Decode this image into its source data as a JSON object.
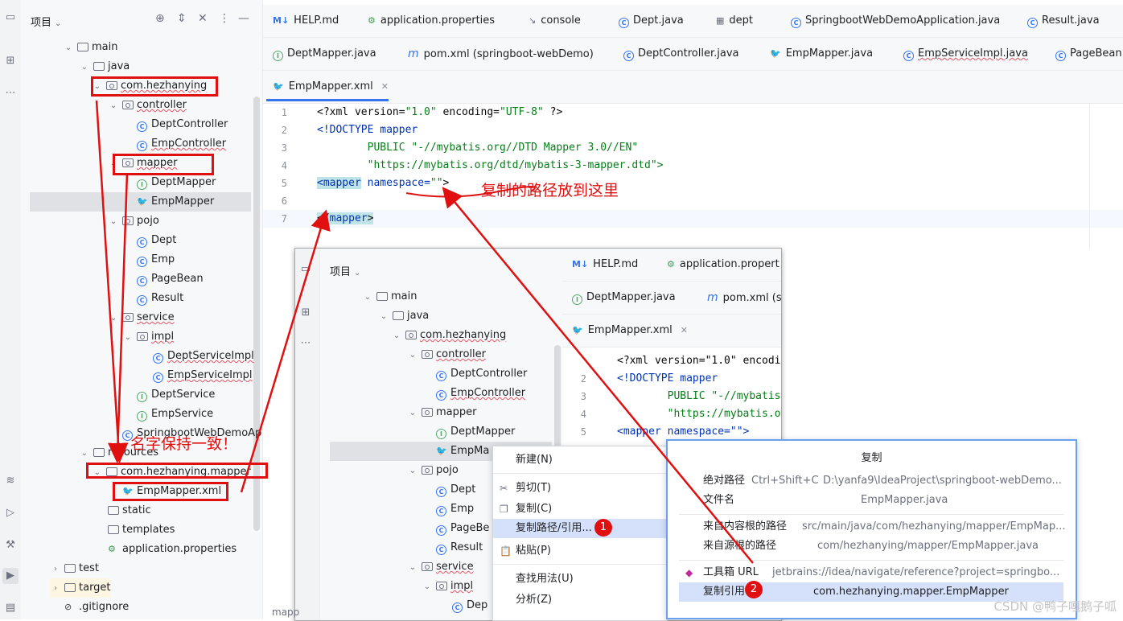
{
  "project_panel": {
    "title": "项目",
    "tree": [
      {
        "label": "main",
        "kind": "folder",
        "chev": "⌄"
      },
      {
        "label": "java",
        "kind": "folder",
        "chev": "⌄"
      },
      {
        "label": "com.hezhanying",
        "kind": "package",
        "chev": "⌄"
      },
      {
        "label": "controller",
        "kind": "package",
        "chev": "⌄"
      },
      {
        "label": "DeptController",
        "kind": "class",
        "chev": ""
      },
      {
        "label": "EmpController",
        "kind": "class",
        "chev": ""
      },
      {
        "label": "mapper",
        "kind": "package",
        "chev": "⌄"
      },
      {
        "label": "DeptMapper",
        "kind": "interface",
        "chev": ""
      },
      {
        "label": "EmpMapper",
        "kind": "mybatis",
        "chev": ""
      },
      {
        "label": "pojo",
        "kind": "package",
        "chev": "⌄"
      },
      {
        "label": "Dept",
        "kind": "class",
        "chev": ""
      },
      {
        "label": "Emp",
        "kind": "class",
        "chev": ""
      },
      {
        "label": "PageBean",
        "kind": "class",
        "chev": ""
      },
      {
        "label": "Result",
        "kind": "class",
        "chev": ""
      },
      {
        "label": "service",
        "kind": "package",
        "chev": "⌄"
      },
      {
        "label": "impl",
        "kind": "package",
        "chev": "⌄"
      },
      {
        "label": "DeptServiceImpl",
        "kind": "class",
        "chev": ""
      },
      {
        "label": "EmpServiceImpl",
        "kind": "class",
        "chev": ""
      },
      {
        "label": "DeptService",
        "kind": "interface",
        "chev": ""
      },
      {
        "label": "EmpService",
        "kind": "interface",
        "chev": ""
      },
      {
        "label": "SpringbootWebDemoApp",
        "kind": "class",
        "chev": ""
      },
      {
        "label": "resources",
        "kind": "folder",
        "chev": "⌄"
      },
      {
        "label": "com.hezhanying.mapper",
        "kind": "folder",
        "chev": "⌄"
      },
      {
        "label": "EmpMapper.xml",
        "kind": "mybatis",
        "chev": ""
      },
      {
        "label": "static",
        "kind": "folder",
        "chev": ""
      },
      {
        "label": "templates",
        "kind": "folder",
        "chev": ""
      },
      {
        "label": "application.properties",
        "kind": "properties",
        "chev": ""
      },
      {
        "label": "test",
        "kind": "folder",
        "chev": "›"
      },
      {
        "label": "target",
        "kind": "folder",
        "chev": "›"
      },
      {
        "label": ".gitignore",
        "kind": "ignore",
        "chev": ""
      }
    ]
  },
  "tabs_row1": [
    "HELP.md",
    "application.properties",
    "console",
    "Dept.java",
    "dept",
    "SpringbootWebDemoApplication.java",
    "Result.java"
  ],
  "tabs_row2": [
    "DeptMapper.java",
    "pom.xml (springboot-webDemo)",
    "DeptController.java",
    "EmpMapper.java",
    "EmpServiceImpl.java",
    "PageBean"
  ],
  "tabs_row3": [
    "EmpMapper.xml"
  ],
  "code": {
    "line_numbers": [
      "1",
      "2",
      "3",
      "4",
      "5",
      "6",
      "7"
    ],
    "lines": {
      "l1a": "<?xml version=",
      "l1b": "\"1.0\"",
      "l1c": " encoding=",
      "l1d": "\"UTF-8\"",
      "l1e": " ?>",
      "l2": "<!DOCTYPE mapper",
      "l3": "        PUBLIC \"-//mybatis.org//DTD Mapper 3.0//EN\"",
      "l4": "        \"https://mybatis.org/dtd/mybatis-3-mapper.dtd\">",
      "l5a": "<mapper",
      "l5b": " namespace=",
      "l5c": "\"\"",
      "l5d": ">",
      "l7a": "</",
      "l7b": "mapper",
      "l7c": ">"
    }
  },
  "annotations": {
    "copy_here": "复制的路径放到这里",
    "same_name": "名字保持一致！"
  },
  "inset": {
    "title": "项目",
    "tabs_row1": [
      "HELP.md",
      "application.propert"
    ],
    "tabs_row2": [
      "DeptMapper.java",
      "pom.xml (s"
    ],
    "tabs_row3": [
      "EmpMapper.xml"
    ],
    "tree": [
      "main",
      "java",
      "com.hezhanying",
      "controller",
      "DeptController",
      "EmpController",
      "mapper",
      "DeptMapper",
      "EmpMa",
      "pojo",
      "Dept",
      "Emp",
      "PageBe",
      "Result",
      "service",
      "impl",
      "Dep"
    ],
    "code_lines": [
      "<?xml version=\"1.0\" encodi",
      "<!DOCTYPE mapper",
      "        PUBLIC \"-//mybatis",
      "        \"https://mybatis.o",
      "<mapper namespace=\"\">"
    ],
    "line_numbers": [
      "2",
      "3",
      "4",
      "5"
    ]
  },
  "context_menu": {
    "items": [
      {
        "label": "新建(N)",
        "icon": ""
      },
      {
        "label": "剪切(T)",
        "icon": "✂"
      },
      {
        "label": "复制(C)",
        "icon": "❐"
      },
      {
        "label": "复制路径/引用...",
        "icon": "",
        "active": true
      },
      {
        "label": "粘贴(P)",
        "icon": "📋"
      },
      {
        "label": "查找用法(U)",
        "icon": ""
      },
      {
        "label": "分析(Z)",
        "icon": ""
      }
    ],
    "badge1": "1"
  },
  "copy_submenu": {
    "title": "复制",
    "items": [
      {
        "label": "绝对路径",
        "shortcut": "Ctrl+Shift+C",
        "value": "D:\\yanfa9\\IdeaProject\\springboot-webDemo..."
      },
      {
        "label": "文件名",
        "shortcut": "",
        "value": "EmpMapper.java"
      },
      {
        "label": "来自内容根的路径",
        "shortcut": "",
        "value": "src/main/java/com/hezhanying/mapper/EmpMap..."
      },
      {
        "label": "来自源根的路径",
        "shortcut": "",
        "value": "com/hezhanying/mapper/EmpMapper.java"
      },
      {
        "label": "工具箱 URL",
        "shortcut": "",
        "value": "jetbrains://idea/navigate/reference?project=springbo..."
      },
      {
        "label": "复制引用",
        "shortcut": "",
        "value": "com.hezhanying.mapper.EmpMapper"
      }
    ],
    "badge2": "2"
  },
  "watermark": "CSDN @鸭子嘎鹅子呱",
  "bottom_crumb": "mapp"
}
